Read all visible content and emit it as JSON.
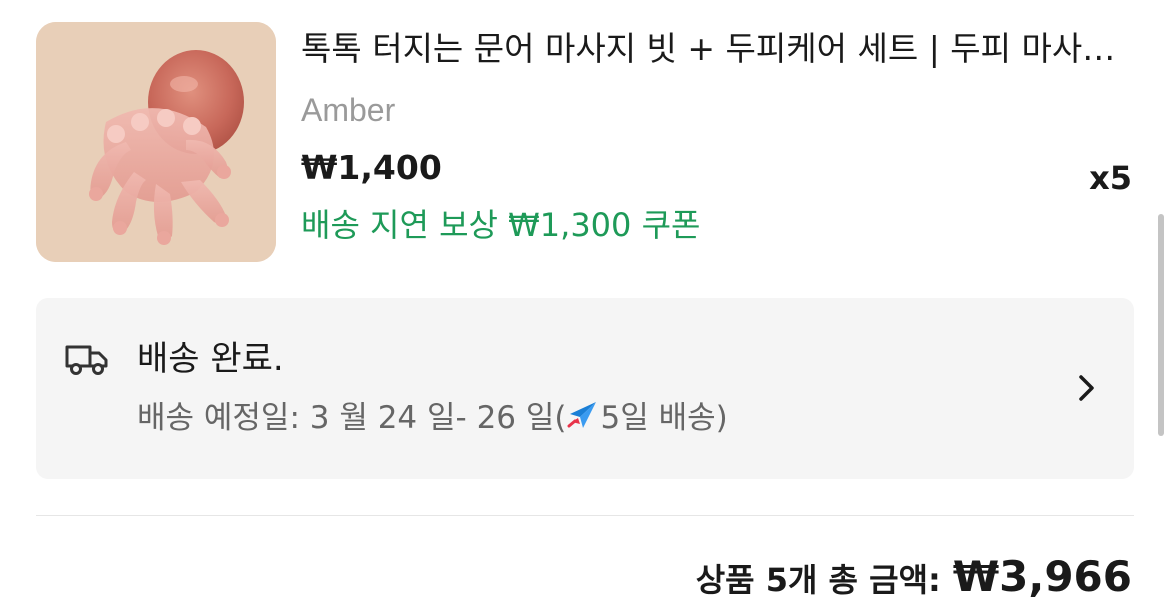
{
  "product": {
    "title": "톡톡 터지는 문어 마사지 빗 + 두피케어 세트 | 두피 마사지 빗",
    "variant": "Amber",
    "price": "₩1,400",
    "coupon": "배송 지연 보상 ₩1,300 쿠폰",
    "quantity": "x5",
    "image_icon": "octopus-scalp-massager",
    "accent_color": "#1e9a58"
  },
  "shipping": {
    "status": "배송 완료.",
    "eta_prefix": "배송 예정일: 3 월 24 일- 26 일(",
    "eta_days": "5일 배송)",
    "icons": [
      "truck-icon",
      "plane-icon",
      "chevron-right-icon"
    ]
  },
  "summary": {
    "total_label": "상품 5개 총 금액:",
    "total_amount": "₩3,966"
  }
}
